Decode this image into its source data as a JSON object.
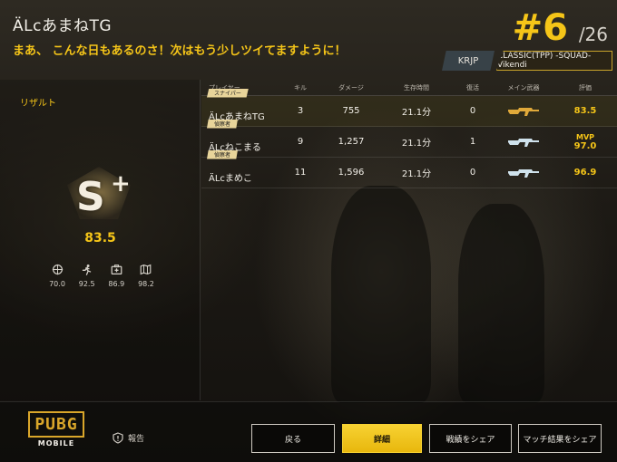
{
  "header": {
    "player_name": "ÄLcあまねTG",
    "message": "まあ、 こんな日もあるのさ！次はもう少しツイてますように！",
    "rank": "#6",
    "rank_total": "/26",
    "region": "KRJP",
    "mode": "CLASSIC(TPP) -SQUAD-Vikendi"
  },
  "result": {
    "title": "リザルト",
    "grade": "S",
    "grade_plus": "+",
    "score": "83.5",
    "stats": [
      {
        "icon": "crosshair-icon",
        "value": "70.0"
      },
      {
        "icon": "runner-icon",
        "value": "92.5"
      },
      {
        "icon": "medkit-icon",
        "value": "86.9"
      },
      {
        "icon": "map-icon",
        "value": "98.2"
      }
    ]
  },
  "table": {
    "headers": [
      "プレイヤー",
      "キル",
      "ダメージ",
      "生存時間",
      "復活",
      "メイン武器",
      "評価"
    ],
    "rows": [
      {
        "badge": "スナイパー",
        "name": "ÄLcあまねTG",
        "kills": "3",
        "damage": "755",
        "time": "21.1分",
        "revives": "0",
        "weapon": "gold-rifle-icon",
        "mvp": "",
        "rating": "83.5"
      },
      {
        "badge": "偵察者",
        "name": "ÄLcねこまる",
        "kills": "9",
        "damage": "1,257",
        "time": "21.1分",
        "revives": "1",
        "weapon": "rifle-icon",
        "mvp": "MVP",
        "rating": "97.0"
      },
      {
        "badge": "偵察者",
        "name": "ÄLcまめこ",
        "kills": "11",
        "damage": "1,596",
        "time": "21.1分",
        "revives": "0",
        "weapon": "rifle-icon",
        "mvp": "",
        "rating": "96.9"
      }
    ]
  },
  "footer": {
    "logo_main": "PUBG",
    "logo_sub": "MOBILE",
    "report": "報告",
    "buttons": {
      "back": "戻る",
      "details": "詳細",
      "share_stats": "戦績をシェア",
      "share_match": "マッチ結果をシェア"
    }
  },
  "colors": {
    "accent": "#f5c518",
    "background": "#1d1a15"
  }
}
